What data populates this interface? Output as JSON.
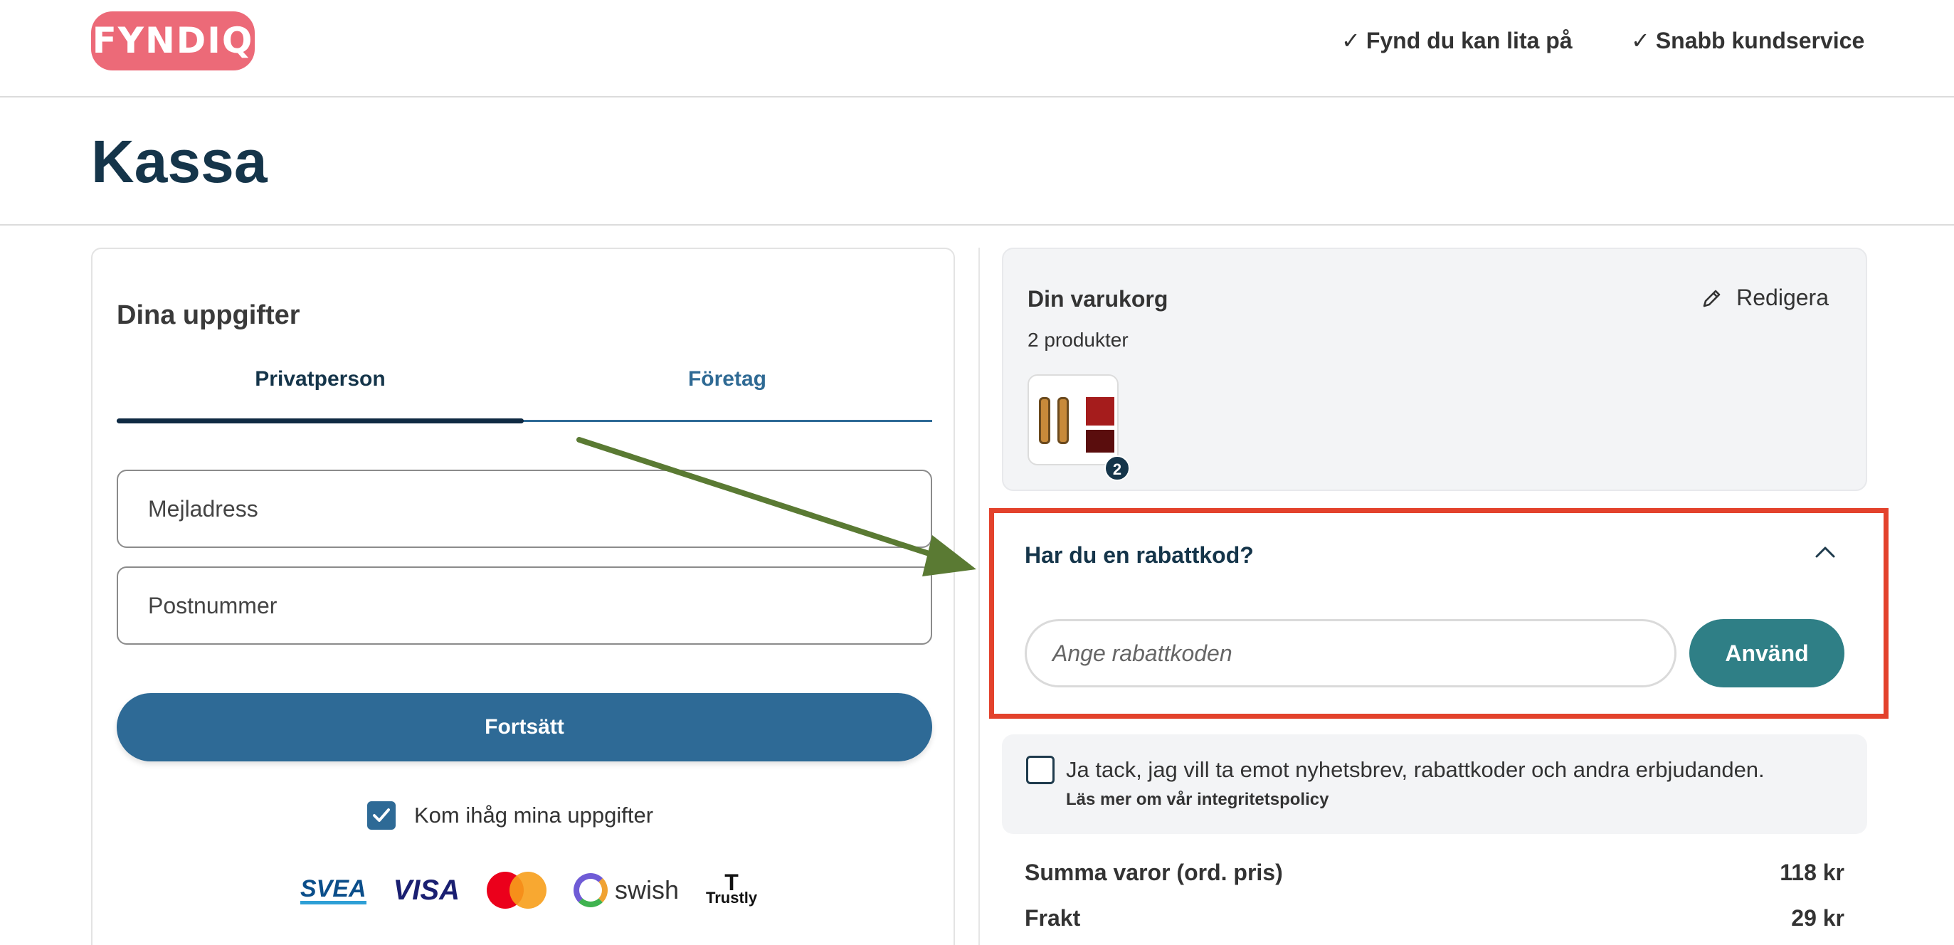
{
  "header": {
    "logo": "FYNDIQ",
    "usps": [
      "Fynd du kan lita på",
      "Snabb kundservice"
    ],
    "check_glyph": "✓"
  },
  "page": {
    "title": "Kassa"
  },
  "details": {
    "title": "Dina uppgifter",
    "tabs": [
      {
        "label": "Privatperson",
        "active": true
      },
      {
        "label": "Företag",
        "active": false
      }
    ],
    "fields": {
      "email": {
        "placeholder": "Mejladress",
        "value": ""
      },
      "postal": {
        "placeholder": "Postnummer",
        "value": ""
      }
    },
    "continue_label": "Fortsätt",
    "remember": {
      "label": "Kom ihåg mina uppgifter",
      "checked": true
    },
    "payment_methods": [
      "SVEA",
      "VISA",
      "Mastercard",
      "swish",
      "Trustly"
    ],
    "payment_labels": {
      "svea": "SVEA",
      "visa": "VISA",
      "swish": "swish",
      "trustly": "Trustly"
    }
  },
  "cart": {
    "title": "Din varukorg",
    "edit_label": "Redigera",
    "count_text": "2 produkter",
    "badge_count": "2"
  },
  "discount": {
    "title": "Har du en rabattkod?",
    "placeholder": "Ange rabattkoden",
    "apply_label": "Använd",
    "expanded": true
  },
  "newsletter": {
    "checked": false,
    "text": "Ja tack, jag vill ta emot nyhetsbrev, rabattkoder och andra erbjudanden.",
    "link": "Läs mer om vår integritetspolicy"
  },
  "summary": [
    {
      "label": "Summa varor (ord. pris)",
      "value": "118 kr"
    },
    {
      "label": "Frakt",
      "value": "29 kr"
    }
  ],
  "colors": {
    "brand": "#ec6a78",
    "primary": "#2e6a96",
    "apply": "#2f7f86",
    "highlight": "#e3422c",
    "arrow": "#5a7a33"
  },
  "icons": [
    "pencil-icon",
    "chevron-up-icon",
    "checkmark-icon"
  ]
}
